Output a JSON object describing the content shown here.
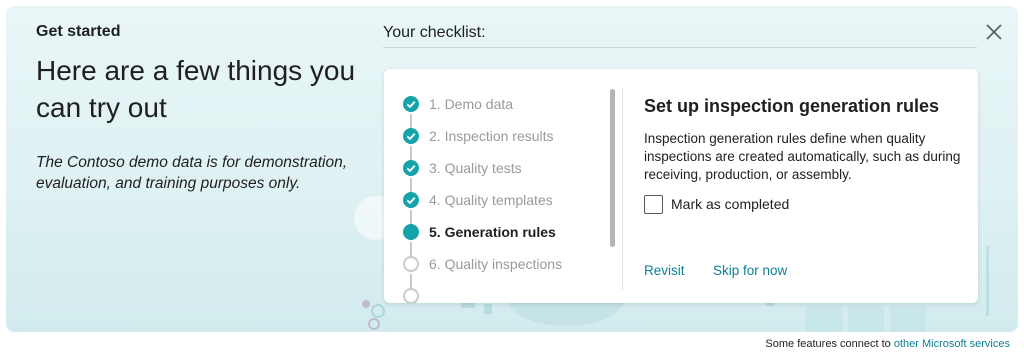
{
  "header": {
    "eyebrow": "Get started",
    "headline": "Here are a few things you can try out",
    "note": "The Contoso demo data is for demonstration, evaluation, and training purposes only."
  },
  "checklist": {
    "title": "Your checklist:",
    "steps": [
      {
        "label": "1. Demo data",
        "state": "done"
      },
      {
        "label": "2. Inspection results",
        "state": "done"
      },
      {
        "label": "3. Quality tests",
        "state": "done"
      },
      {
        "label": "4. Quality templates",
        "state": "done"
      },
      {
        "label": "5. Generation rules",
        "state": "current"
      },
      {
        "label": "6. Quality inspections",
        "state": "todo"
      }
    ]
  },
  "detail": {
    "title": "Set up inspection generation rules",
    "description": "Inspection generation rules define when quality inspections are created automatically, such as during receiving, production, or assembly.",
    "checkbox_label": "Mark as completed",
    "revisit_label": "Revisit",
    "skip_label": "Skip for now"
  },
  "footer": {
    "text": "Some features connect to",
    "link": "other Microsoft services"
  },
  "colors": {
    "accent": "#14a3a8",
    "link": "#0e7f96",
    "panel_bg": "#dff1f3"
  }
}
